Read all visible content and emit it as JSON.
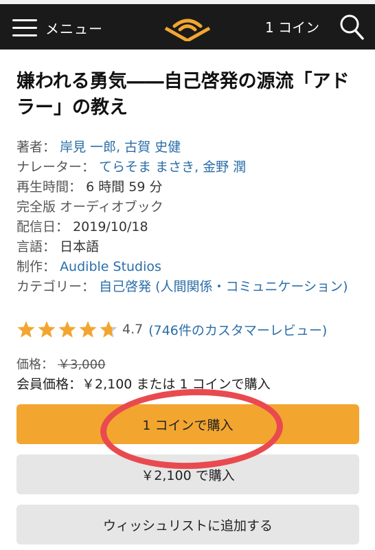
{
  "header": {
    "menu_label": "メニュー",
    "coins_label": "1 コイン",
    "brand_color": "#f2a630"
  },
  "book": {
    "title": "嫌われる勇気――自己啓発の源流「アドラー」の教え",
    "author_label": "著者：",
    "authors": "岸見 一郎, 古賀 史健",
    "narrator_label": "ナレーター：",
    "narrators": "てらそま まさき, 金野 潤",
    "length_label": "再生時間：",
    "length_value": "6 時間 59 分",
    "format": "完全版 オーディオブック",
    "release_label": "配信日：",
    "release_value": "2019/10/18",
    "language_label": "言語：",
    "language_value": "日本語",
    "publisher_label": "制作：",
    "publisher_value": "Audible Studios",
    "category_label": "カテゴリー：",
    "category_value": "自己啓発 (人間関係・コミュニケーション)"
  },
  "rating": {
    "value": "4.7",
    "stars": 4.7,
    "reviews_link": "(746件のカスタマーレビュー)"
  },
  "pricing": {
    "price_label": "価格：",
    "list_price": "￥3,000",
    "member_price": "会員価格：￥2,100 または 1 コインで購入"
  },
  "buttons": {
    "buy_with_coin": "1 コインで購入",
    "buy_with_price": "￥2,100 で購入",
    "add_to_wishlist": "ウィッシュリストに追加する"
  },
  "annotation": {
    "circle_color": "#e94a4f"
  }
}
